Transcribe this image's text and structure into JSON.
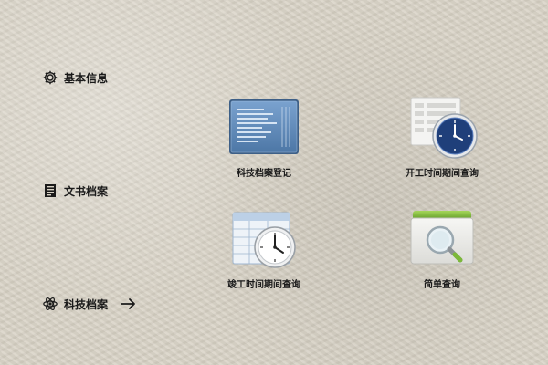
{
  "sidebar": {
    "items": [
      {
        "label": "基本信息",
        "icon": "gear-icon"
      },
      {
        "label": "文书档案",
        "icon": "document-icon"
      },
      {
        "label": "科技档案",
        "icon": "atom-icon",
        "active_indicator": "arrow-right-icon"
      }
    ]
  },
  "tiles": [
    {
      "label": "科技档案登记",
      "icon": "blueprint-register-icon"
    },
    {
      "label": "开工时间期间查询",
      "icon": "clock-list-icon"
    },
    {
      "label": "竣工时间期间查询",
      "icon": "clock-form-icon"
    },
    {
      "label": "简单查询",
      "icon": "magnifier-box-icon"
    }
  ],
  "colors": {
    "background": "#d8d2c5",
    "text": "#1a1a1a",
    "blueprint": "#5f86b3",
    "clock_face": "#1f3f7a",
    "green_accent": "#7cb83a"
  }
}
